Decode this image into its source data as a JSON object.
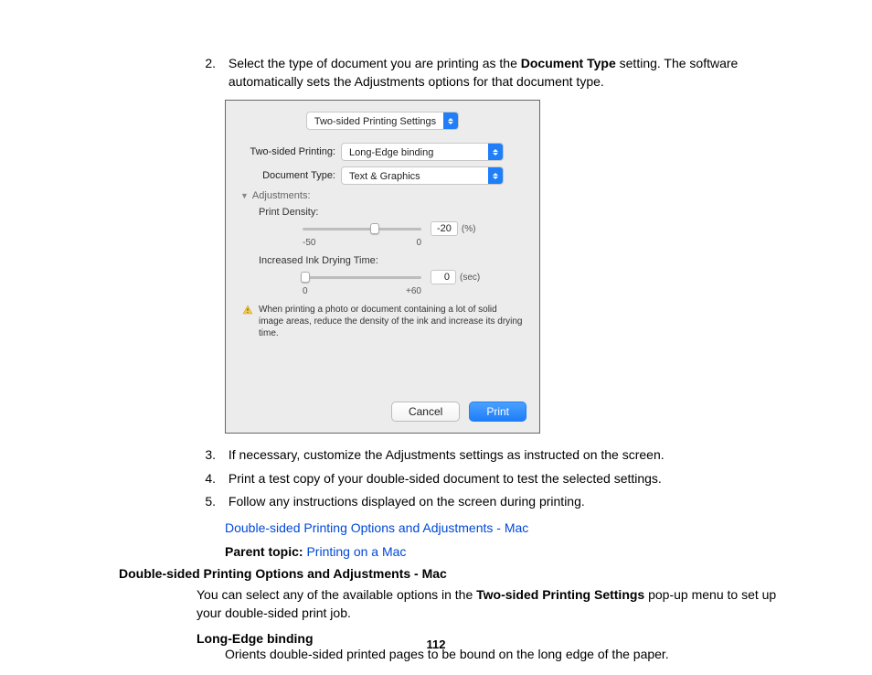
{
  "steps": {
    "s2_pre": "Select the type of document you are printing as the ",
    "s2_bold": "Document Type",
    "s2_post": " setting. The software automatically sets the Adjustments options for that document type.",
    "s3": "If necessary, customize the Adjustments settings as instructed on the screen.",
    "s4": "Print a test copy of your double-sided document to test the selected settings.",
    "s5": "Follow any instructions displayed on the screen during printing."
  },
  "dialog": {
    "menu": "Two-sided Printing Settings",
    "row1_label": "Two-sided Printing:",
    "row1_value": "Long-Edge binding",
    "row2_label": "Document Type:",
    "row2_value": "Text & Graphics",
    "adjustments": "Adjustments:",
    "print_density_label": "Print Density:",
    "print_density_value": "-20",
    "pd_unit": "(%)",
    "pd_min": "-50",
    "pd_max": "0",
    "drying_label": "Increased Ink Drying Time:",
    "drying_value": "0",
    "dry_unit": "(sec)",
    "dry_min": "0",
    "dry_max": "+60",
    "warning": "When printing a photo or document containing a lot of solid image areas, reduce the density of the ink and increase its drying time.",
    "cancel": "Cancel",
    "print": "Print"
  },
  "link1": "Double-sided Printing Options and Adjustments - Mac",
  "parent_label": "Parent topic: ",
  "parent_link": "Printing on a Mac",
  "heading": "Double-sided Printing Options and Adjustments - Mac",
  "body_pre": "You can select any of the available options in the ",
  "body_bold": "Two-sided Printing Settings",
  "body_post": " pop-up menu to set up your double-sided print job.",
  "term": "Long-Edge binding",
  "def": "Orients double-sided printed pages to be bound on the long edge of the paper.",
  "page": "112"
}
